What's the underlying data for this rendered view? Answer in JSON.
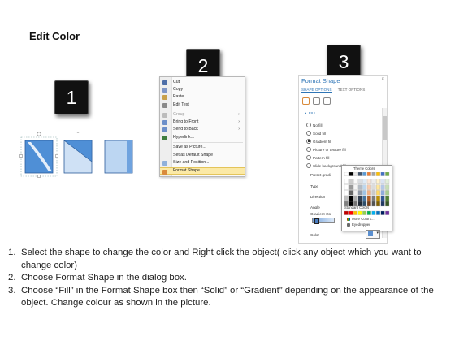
{
  "title": "Edit Color",
  "steps": [
    "1",
    "2",
    "3"
  ],
  "context_menu": {
    "items": [
      {
        "label": "Cut",
        "icon": "scissors-icon",
        "color": "#4d6ea8"
      },
      {
        "label": "Copy",
        "icon": "copy-icon",
        "color": "#7f96c6"
      },
      {
        "label": "Paste",
        "icon": "paste-icon",
        "color": "#c9a14a"
      },
      {
        "label": "Edit Text",
        "icon": "edit-text-icon",
        "color": "#888888"
      },
      {
        "label": "Group",
        "icon": "group-icon",
        "color": "#bbbbbb",
        "disabled": true,
        "submenu": true
      },
      {
        "label": "Bring to Front",
        "icon": "bring-to-front-icon",
        "color": "#6c8fc9",
        "submenu": true
      },
      {
        "label": "Send to Back",
        "icon": "send-to-back-icon",
        "color": "#6c8fc9",
        "submenu": true
      },
      {
        "label": "Hyperlink...",
        "icon": "hyperlink-icon",
        "color": "#3f7d3f"
      },
      {
        "label": "Save as Picture...",
        "icon": "",
        "color": ""
      },
      {
        "label": "Set as Default Shape",
        "icon": "",
        "color": ""
      },
      {
        "label": "Size and Position...",
        "icon": "size-position-icon",
        "color": "#8fb0d9"
      },
      {
        "label": "Format Shape...",
        "icon": "format-shape-icon",
        "color": "#d98a3a",
        "highlighted": true
      }
    ]
  },
  "format_pane": {
    "title": "Format Shape",
    "close": "×",
    "tabs": [
      "SHAPE OPTIONS",
      "TEXT OPTIONS"
    ],
    "fill_header": "▲ FILL",
    "fill_options": [
      "No fill",
      "Solid fill",
      "Gradient fill",
      "Picture or texture fill",
      "Pattern fill",
      "Slide background fill"
    ],
    "selected_fill": "Gradient fill",
    "props": [
      "Preset gradi",
      "Type",
      "Direction",
      "Angle",
      "Gradient sto",
      "Color"
    ]
  },
  "palette": {
    "theme_label": "Theme Colors",
    "standard_label": "Standard Colors",
    "more_colors": "More Colors...",
    "eyedropper": "Eyedropper",
    "theme_top": [
      "#ffffff",
      "#000000",
      "#e7e6e6",
      "#44546a",
      "#5b9bd5",
      "#ed7d31",
      "#a5a5a5",
      "#ffc000",
      "#4472c4",
      "#70ad47"
    ],
    "standard": [
      "#c00000",
      "#ff0000",
      "#ffc000",
      "#ffff00",
      "#92d050",
      "#00b050",
      "#00b0f0",
      "#0070c0",
      "#002060",
      "#7030a0"
    ]
  },
  "instructions": [
    {
      "num": "1.",
      "text": "Select the shape to change the color and Right click the object( click any object which you want to change color)"
    },
    {
      "num": "2.",
      "text": "Choose Format Shape in the dialog box."
    },
    {
      "num": "3.",
      "text": "Choose “Fill” in the Format Shape box then “Solid” or “Gradient” depending on the appearance of the object. Change colour as shown in the picture."
    }
  ]
}
